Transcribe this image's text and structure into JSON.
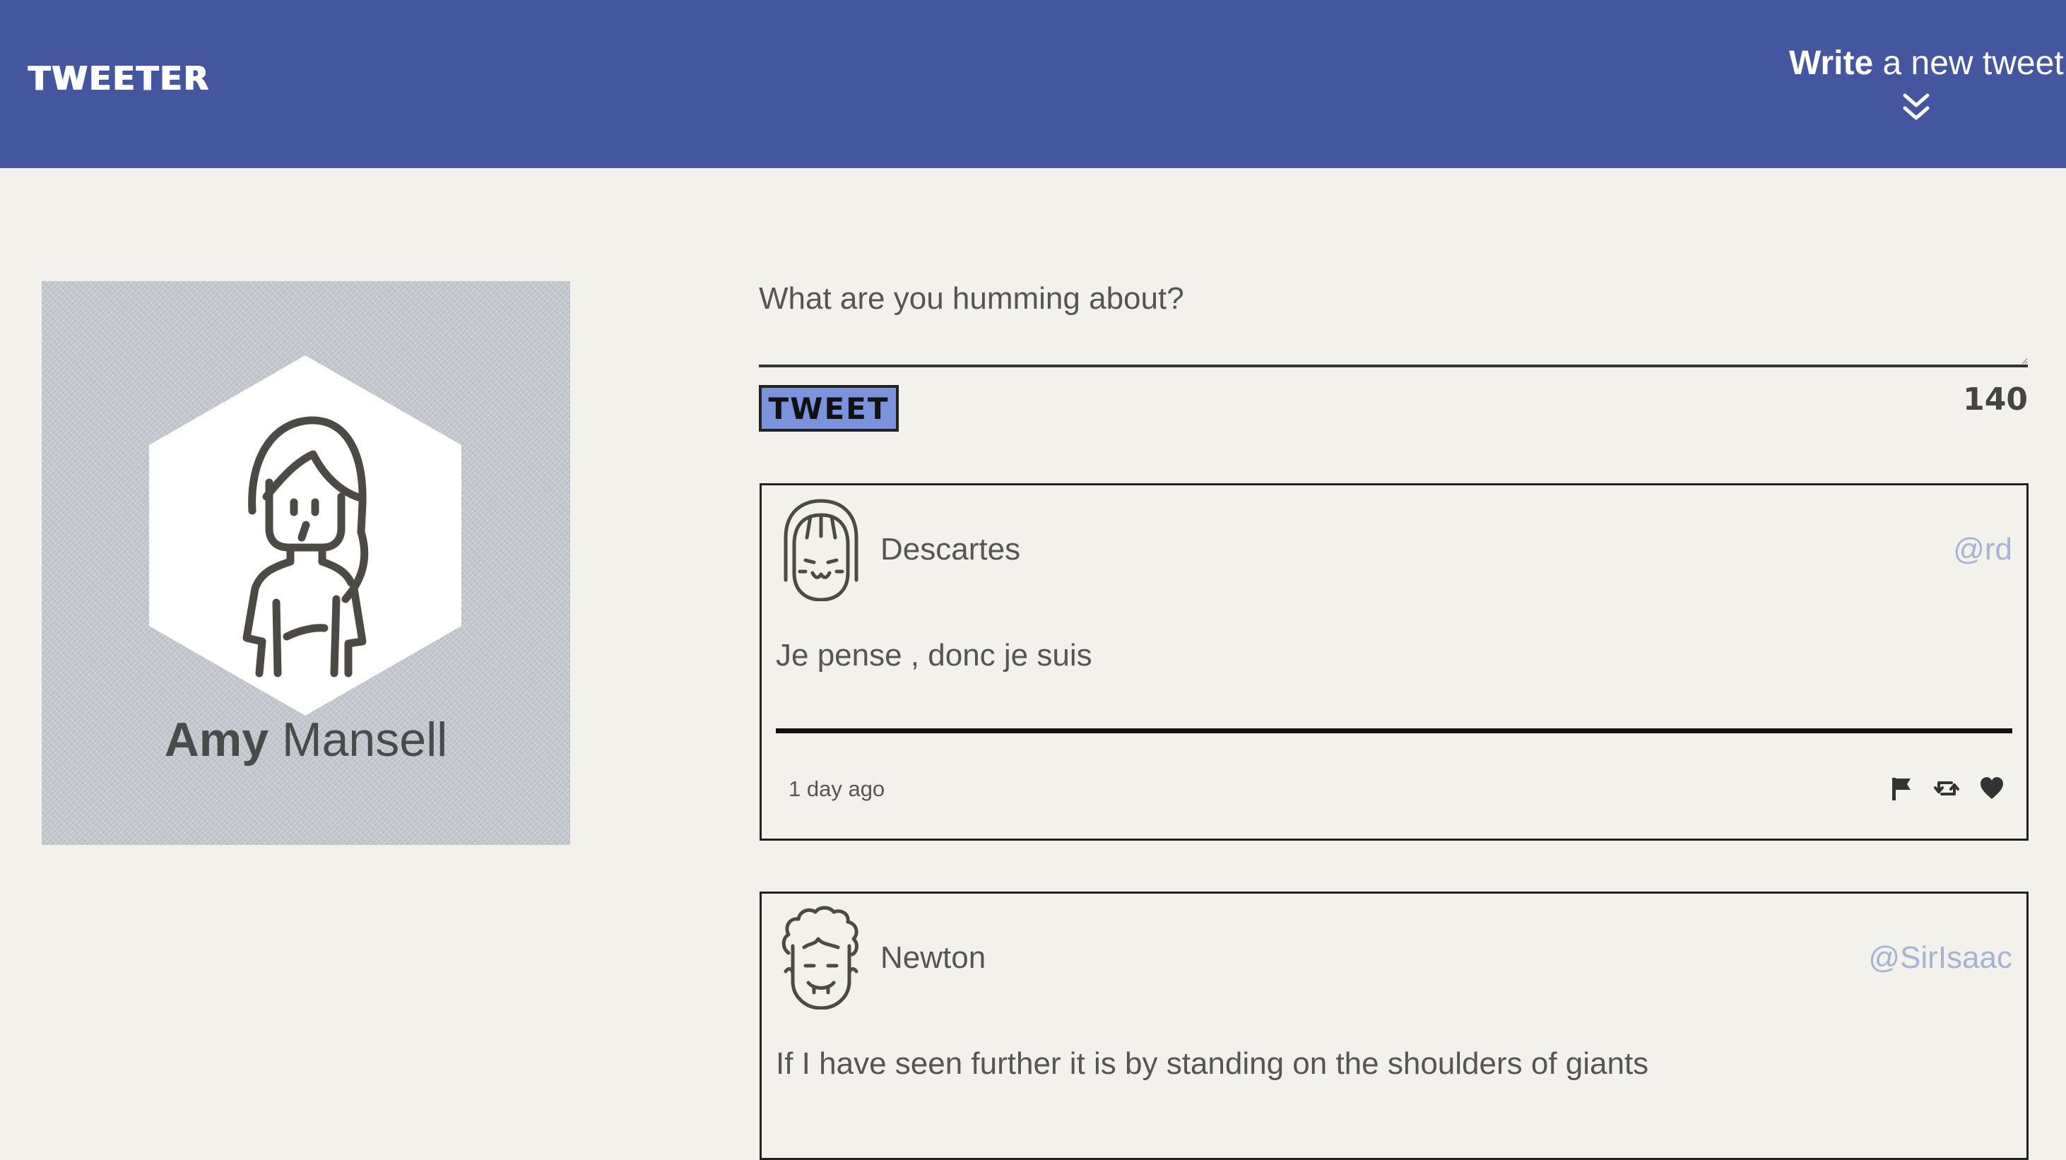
{
  "header": {
    "brand": "TWEETER",
    "compose_toggle_strong": "Write",
    "compose_toggle_rest": " a new tweet",
    "compose_toggle_icon": "double-chevron-down-icon",
    "background_color": "#4556a0"
  },
  "profile": {
    "avatar_icon": "woman-avatar-icon",
    "first_name": "Amy",
    "last_name": " Mansell"
  },
  "compose": {
    "placeholder": "What are you humming about?",
    "button_label": "TWEET",
    "char_count": "140",
    "button_color": "#7b93dc"
  },
  "tweets": [
    {
      "avatar_icon": "bangs-girl-avatar-icon",
      "name": "Descartes",
      "handle": "@rd",
      "content": "Je pense , donc je suis",
      "time": "1 day ago",
      "actions": [
        "flag-icon",
        "retweet-icon",
        "heart-icon"
      ]
    },
    {
      "avatar_icon": "curly-hair-man-avatar-icon",
      "name": "Newton",
      "handle": "@SirIsaac",
      "content": "If I have seen further it is by standing on the shoulders of giants"
    }
  ]
}
